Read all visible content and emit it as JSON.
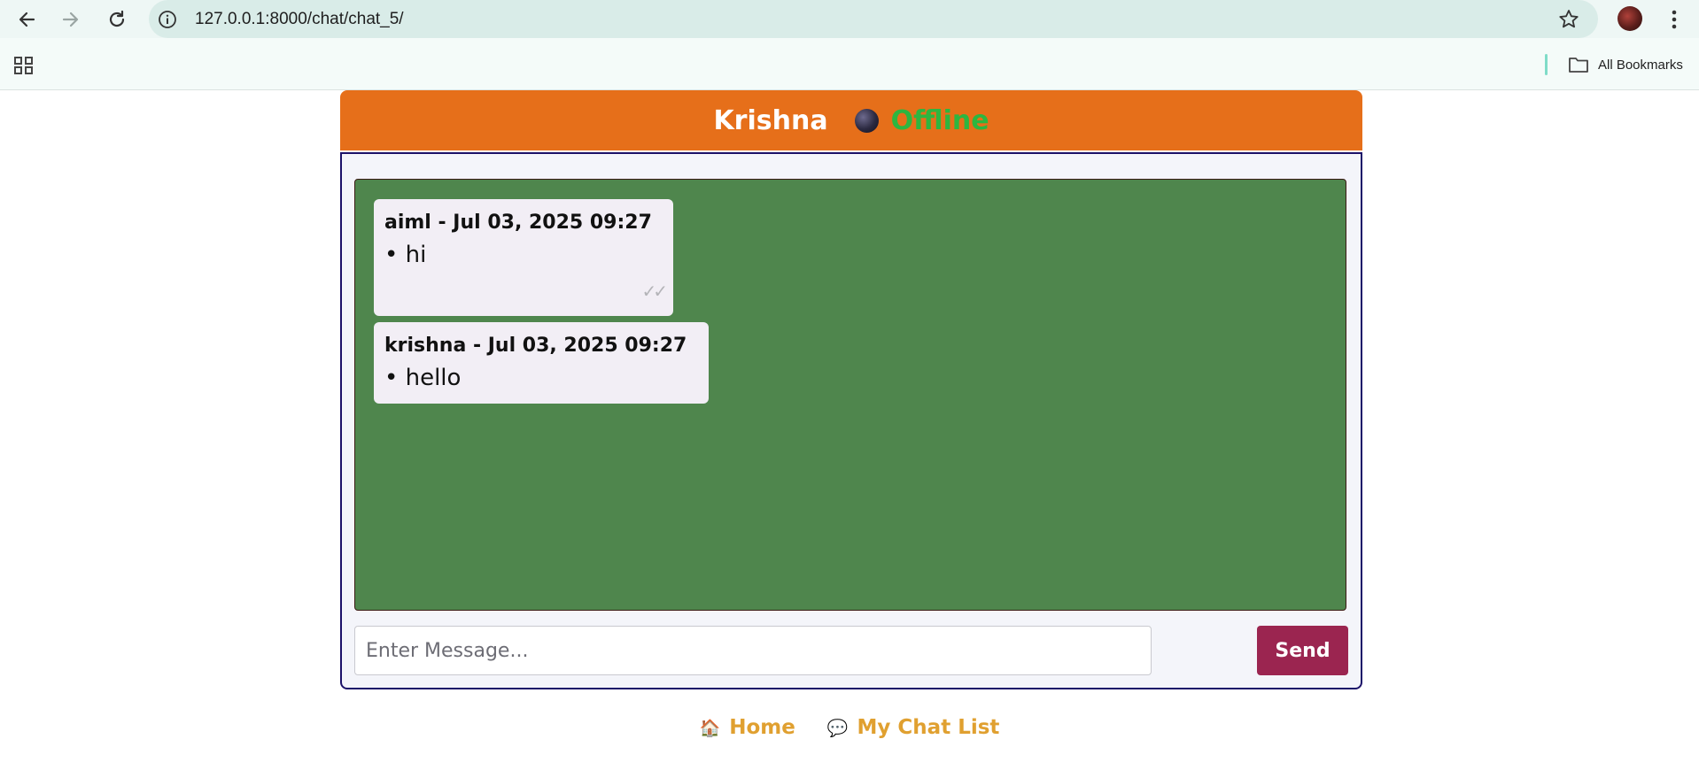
{
  "browser": {
    "url": "127.0.0.1:8000/chat/chat_5/",
    "bookmarks_label": "All Bookmarks"
  },
  "chat": {
    "name": "Krishna",
    "status": "Offline",
    "messages": [
      {
        "meta": "aiml - Jul 03, 2025 09:27",
        "text": "• hi",
        "read_receipt": "✓✓"
      },
      {
        "meta": "krishna - Jul 03, 2025 09:27",
        "text": "• hello"
      }
    ],
    "input_placeholder": "Enter Message...",
    "send_label": "Send"
  },
  "footer": {
    "home_icon": "🏠",
    "home_label": "Home",
    "chatlist_icon": "💬",
    "chatlist_label": "My Chat List"
  },
  "colors": {
    "header": "#e66f1a",
    "status_offline": "#2db640",
    "messages_bg": "#4f864d",
    "send_button": "#9b2550",
    "footer_link": "#e0a030"
  }
}
